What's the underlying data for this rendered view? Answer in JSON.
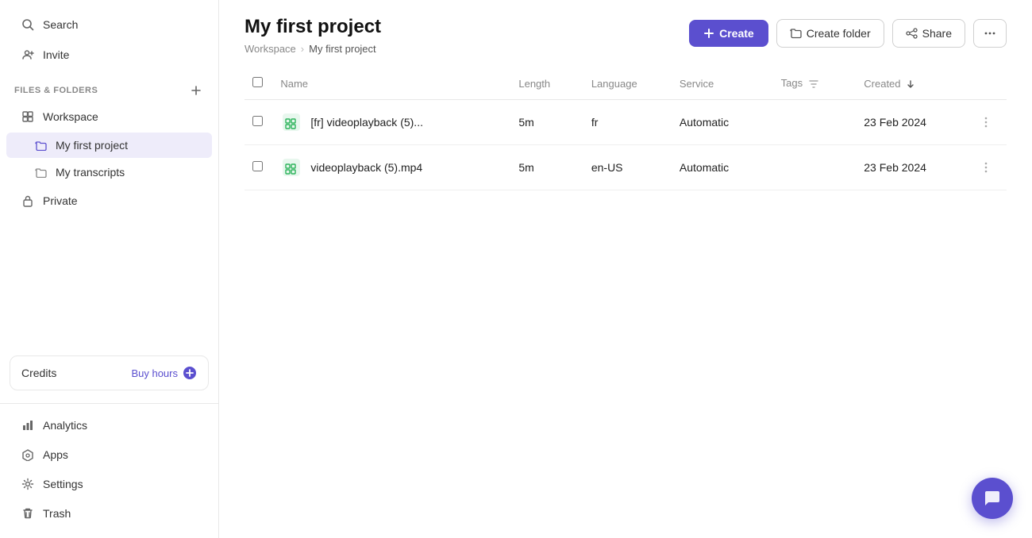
{
  "sidebar": {
    "search_label": "Search",
    "invite_label": "Invite",
    "files_folders_label": "Files & Folders",
    "workspace_label": "Workspace",
    "my_first_project_label": "My first project",
    "my_transcripts_label": "My transcripts",
    "private_label": "Private",
    "credits_label": "Credits",
    "buy_hours_label": "Buy hours",
    "analytics_label": "Analytics",
    "apps_label": "Apps",
    "settings_label": "Settings",
    "trash_label": "Trash"
  },
  "header": {
    "page_title": "My first project",
    "breadcrumb_workspace": "Workspace",
    "breadcrumb_sep": "›",
    "breadcrumb_current": "My first project",
    "create_label": "Create",
    "create_folder_label": "Create folder",
    "share_label": "Share"
  },
  "table": {
    "col_name": "Name",
    "col_length": "Length",
    "col_language": "Language",
    "col_service": "Service",
    "col_tags": "Tags",
    "col_created": "Created",
    "rows": [
      {
        "name": "[fr] videoplayback (5)...",
        "length": "5m",
        "language": "fr",
        "service": "Automatic",
        "tags": "",
        "created": "23 Feb 2024"
      },
      {
        "name": "videoplayback (5).mp4",
        "length": "5m",
        "language": "en-US",
        "service": "Automatic",
        "tags": "",
        "created": "23 Feb 2024"
      }
    ]
  }
}
